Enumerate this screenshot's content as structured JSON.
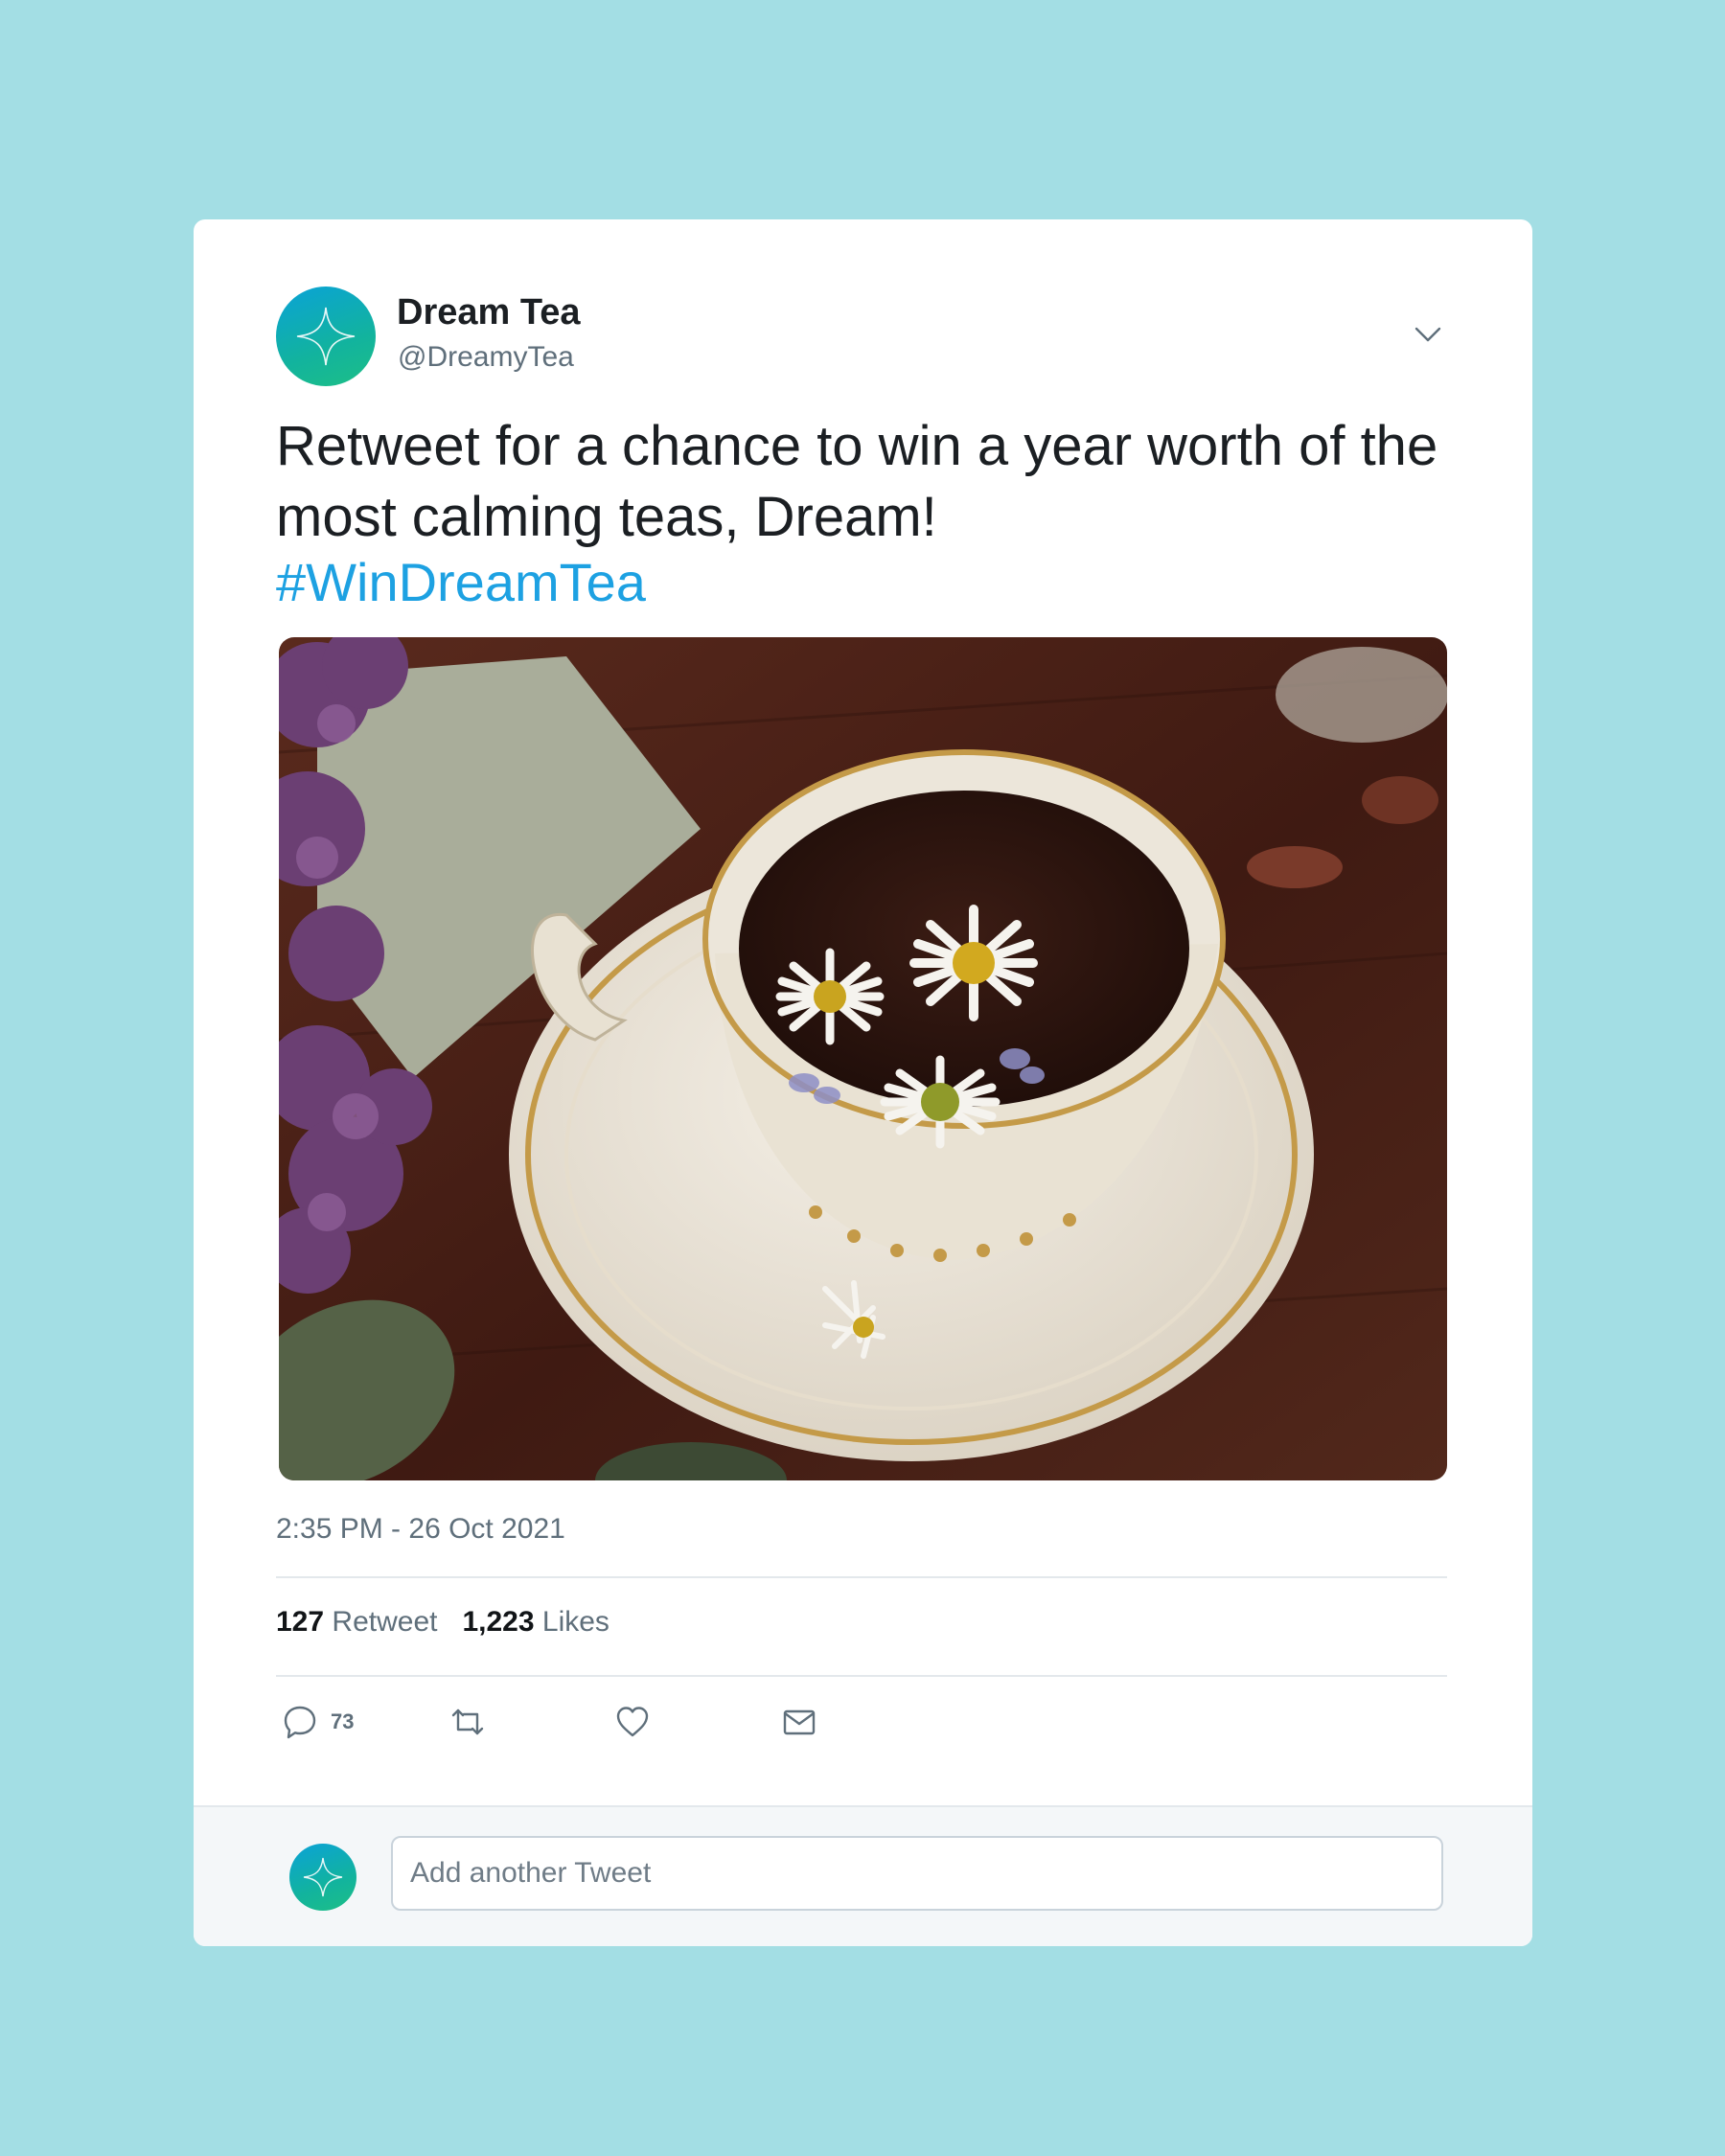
{
  "account": {
    "name": "Dream Tea",
    "handle": "@DreamyTea",
    "avatar_icon": "sparkle-star-icon"
  },
  "tweet": {
    "text": "Retweet for a chance to win a year worth of the most calming teas, Dream!",
    "hashtag": "#WinDreamTea",
    "timestamp": "2:35 PM - 26 Oct 2021"
  },
  "stats": {
    "retweets_count": "127",
    "retweets_label": "Retweet",
    "likes_count": "1,223",
    "likes_label": "Likes"
  },
  "actions": {
    "reply_count": "73",
    "reply_icon": "reply-icon",
    "retweet_icon": "retweet-icon",
    "like_icon": "heart-icon",
    "message_icon": "envelope-icon"
  },
  "reply_box": {
    "placeholder": "Add another Tweet"
  },
  "colors": {
    "background": "#a3dee4",
    "hashtag": "#1da1e2",
    "avatar_gradient_start": "#0aa2d8",
    "avatar_gradient_end": "#1dbf86"
  }
}
